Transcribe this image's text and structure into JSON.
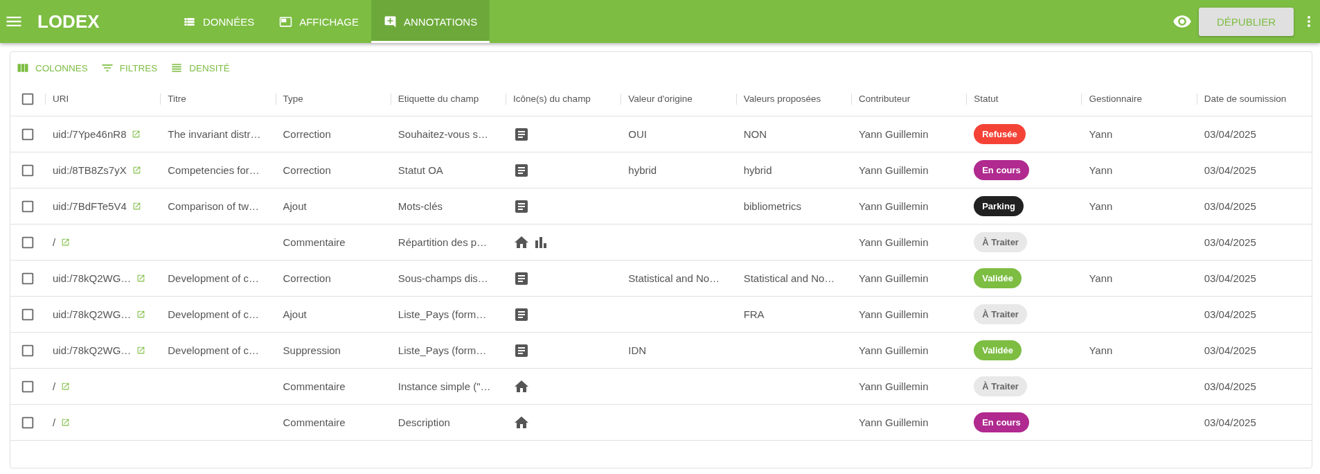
{
  "app": {
    "title": "LODEX"
  },
  "nav_tabs": [
    {
      "label": "DONNÉES",
      "selected": false
    },
    {
      "label": "AFFICHAGE",
      "selected": false
    },
    {
      "label": "ANNOTATIONS",
      "selected": true
    }
  ],
  "actions": {
    "publish_button": "DÉPUBLIER"
  },
  "toolbar": [
    "COLONNES",
    "FILTRES",
    "DENSITÉ"
  ],
  "table": {
    "select_all_checked": false,
    "columns": [
      "URI",
      "Titre",
      "Type",
      "Etiquette du champ",
      "Icône(s) du champ",
      "Valeur d'origine",
      "Valeurs proposées",
      "Contributeur",
      "Statut",
      "Gestionnaire",
      "Date de soumission"
    ],
    "rows": [
      {
        "checked": false,
        "uri": "uid:/7Ype46nR8",
        "title": "The invariant distr…",
        "type": "Correction",
        "field_label": "Souhaitez-vous s…",
        "field_icons": [
          {
            "kind": "document"
          }
        ],
        "initial_value": "OUI",
        "proposed_values": "NON",
        "contributor": "Yann Guillemin",
        "status": {
          "label": "Refusée",
          "color": "#f44336"
        },
        "manager": "Yann",
        "date": "03/04/2025"
      },
      {
        "checked": false,
        "uri": "uid:/8TB8Zs7yX",
        "title": "Competencies for…",
        "type": "Correction",
        "field_label": "Statut OA",
        "field_icons": [
          {
            "kind": "document"
          }
        ],
        "initial_value": "hybrid",
        "proposed_values": "hybrid",
        "contributor": "Yann Guillemin",
        "status": {
          "label": "En cours",
          "color": "#b02a8f"
        },
        "manager": "Yann",
        "date": "03/04/2025"
      },
      {
        "checked": false,
        "uri": "uid:/7BdFTe5V4",
        "title": "Comparison of tw…",
        "type": "Ajout",
        "field_label": "Mots-clés",
        "field_icons": [
          {
            "kind": "document"
          }
        ],
        "initial_value": "",
        "proposed_values": "bibliometrics",
        "contributor": "Yann Guillemin",
        "status": {
          "label": "Parking",
          "color": "#212121"
        },
        "manager": "Yann",
        "date": "03/04/2025"
      },
      {
        "checked": false,
        "uri": "/",
        "title": "",
        "type": "Commentaire",
        "field_label": "Répartition des p…",
        "field_icons": [
          {
            "kind": "home"
          },
          {
            "kind": "chart"
          }
        ],
        "initial_value": "",
        "proposed_values": "",
        "contributor": "Yann Guillemin",
        "status": {
          "label": "À Traiter",
          "color": "#e8e8e8"
        },
        "manager": "",
        "date": "03/04/2025"
      },
      {
        "checked": false,
        "uri": "uid:/78kQ2WG…",
        "title": "Development of c…",
        "type": "Correction",
        "field_label": "Sous-champs dis…",
        "field_icons": [
          {
            "kind": "document"
          }
        ],
        "initial_value": "Statistical and No…",
        "proposed_values": "Statistical and No…",
        "contributor": "Yann Guillemin",
        "status": {
          "label": "Validée",
          "color": "#7dbd42"
        },
        "manager": "Yann",
        "date": "03/04/2025"
      },
      {
        "checked": false,
        "uri": "uid:/78kQ2WG…",
        "title": "Development of c…",
        "type": "Ajout",
        "field_label": "Liste_Pays (form…",
        "field_icons": [
          {
            "kind": "document"
          }
        ],
        "initial_value": "",
        "proposed_values": "FRA",
        "contributor": "Yann Guillemin",
        "status": {
          "label": "À Traiter",
          "color": "#e8e8e8"
        },
        "manager": "",
        "date": "03/04/2025"
      },
      {
        "checked": false,
        "uri": "uid:/78kQ2WG…",
        "title": "Development of c…",
        "type": "Suppression",
        "field_label": "Liste_Pays (form…",
        "field_icons": [
          {
            "kind": "document"
          }
        ],
        "initial_value": "IDN",
        "proposed_values": "",
        "contributor": "Yann Guillemin",
        "status": {
          "label": "Validée",
          "color": "#7dbd42"
        },
        "manager": "Yann",
        "date": "03/04/2025"
      },
      {
        "checked": false,
        "uri": "/",
        "title": "",
        "type": "Commentaire",
        "field_label": "Instance simple (\"…",
        "field_icons": [
          {
            "kind": "home"
          }
        ],
        "initial_value": "",
        "proposed_values": "",
        "contributor": "Yann Guillemin",
        "status": {
          "label": "À Traiter",
          "color": "#e8e8e8"
        },
        "manager": "",
        "date": "03/04/2025"
      },
      {
        "checked": false,
        "uri": "/",
        "title": "",
        "type": "Commentaire",
        "field_label": "Description",
        "field_icons": [
          {
            "kind": "home"
          }
        ],
        "initial_value": "",
        "proposed_values": "",
        "contributor": "Yann Guillemin",
        "status": {
          "label": "En cours",
          "color": "#b02a8f"
        },
        "manager": "",
        "date": "03/04/2025"
      }
    ]
  }
}
